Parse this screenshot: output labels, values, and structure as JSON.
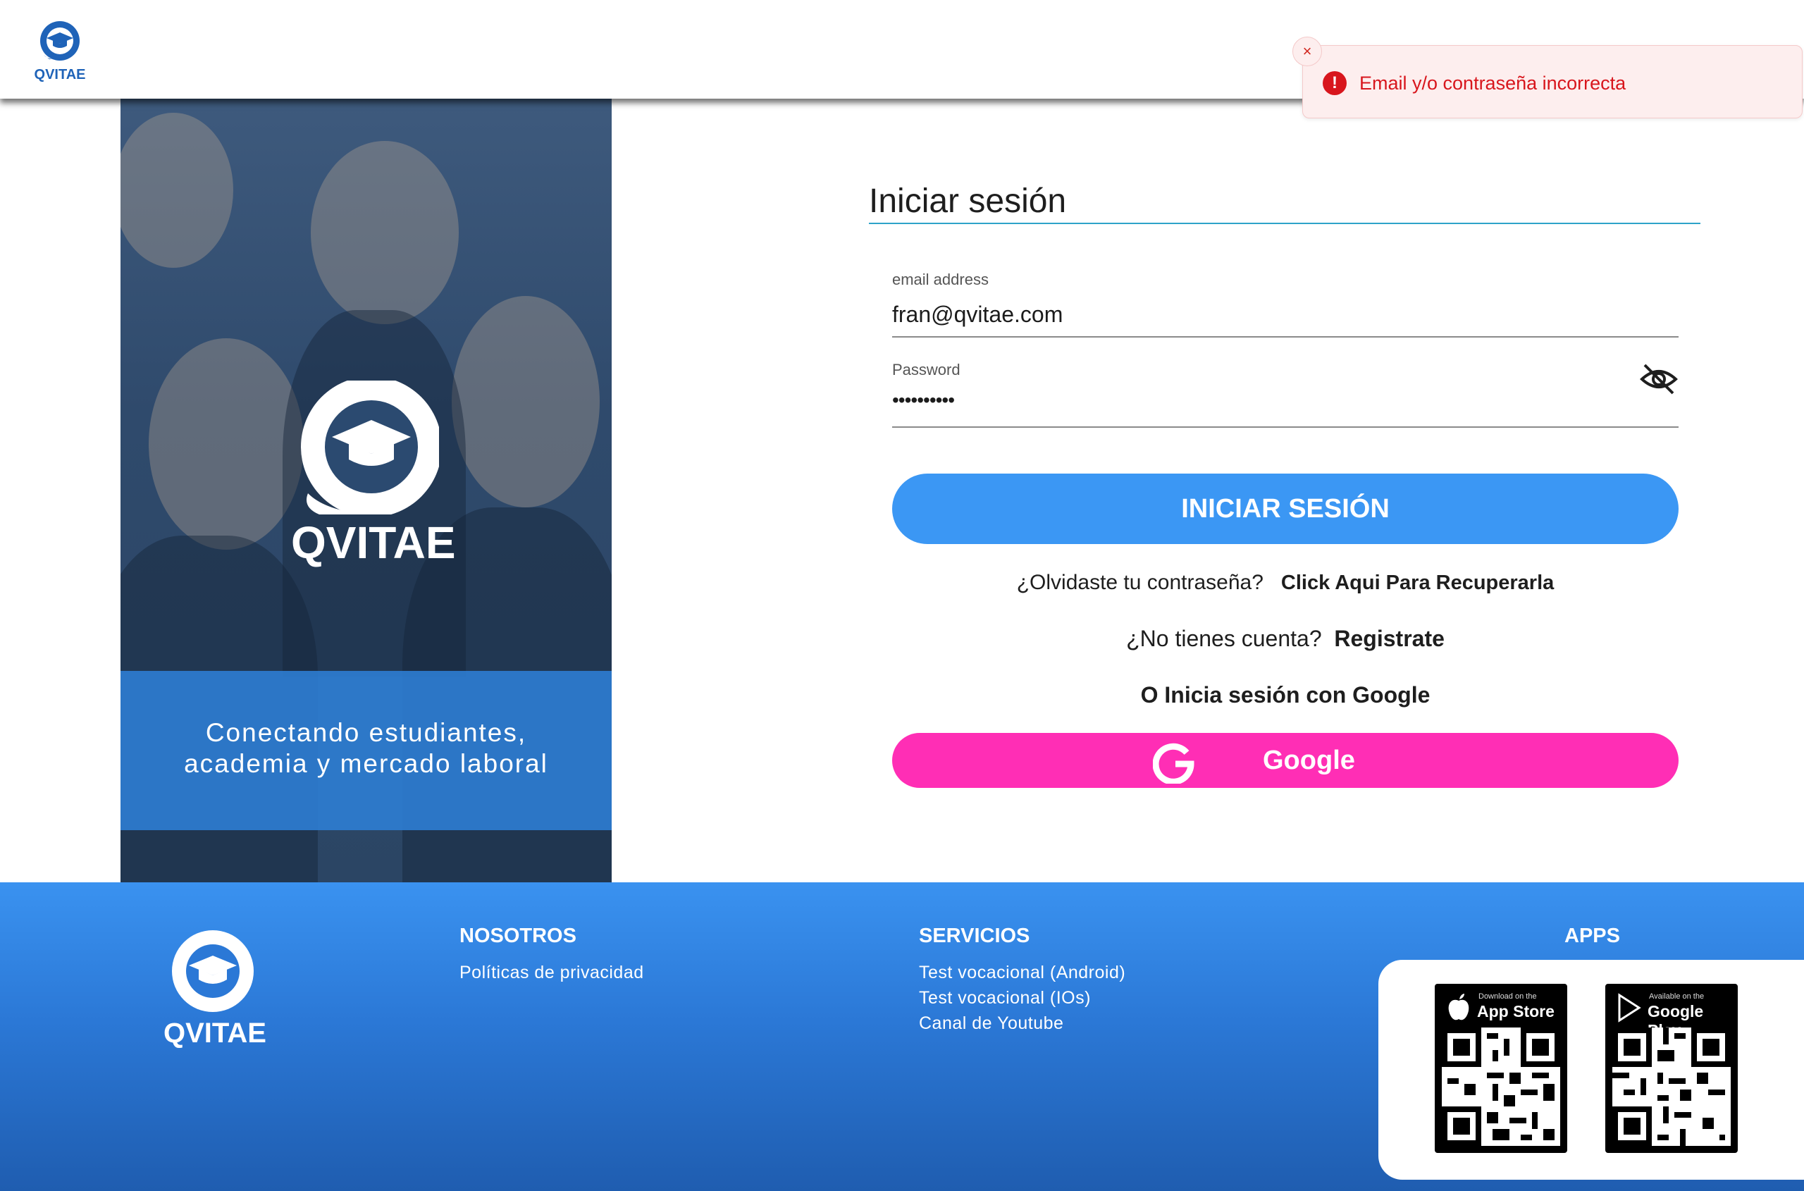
{
  "header": {
    "logo_text": "QVITAE"
  },
  "toast": {
    "close_symbol": "×",
    "icon_symbol": "!",
    "message": "Email y/o contraseña incorrecta",
    "color": "#d8161d"
  },
  "hero": {
    "logo_text": "QVITAE",
    "tagline_line1": "Conectando estudiantes,",
    "tagline_line2": "academia y mercado laboral"
  },
  "form": {
    "title": "Iniciar sesión",
    "email": {
      "label": "email address",
      "value": "fran@qvitae.com"
    },
    "password": {
      "label": "Password",
      "value": "••••••••••",
      "toggle_icon": "eye-off-icon"
    },
    "login_button": "INICIAR SESIÓN",
    "forgot_text": "¿Olvidaste tu contraseña?",
    "forgot_link": "Click Aqui Para Recuperarla",
    "register_text": "¿No tienes cuenta?",
    "register_link": "Registrate",
    "google_prompt": "O Inicia sesión con Google",
    "google_button": "Google"
  },
  "footer": {
    "logo_text": "QVITAE",
    "nosotros": {
      "heading": "NOSOTROS",
      "links": [
        "Políticas de privacidad"
      ]
    },
    "servicios": {
      "heading": "SERVICIOS",
      "links": [
        "Test vocacional (Android)",
        "Test vocacional (IOs)",
        "Canal de Youtube"
      ]
    },
    "apps": {
      "heading": "APPS",
      "app_store": {
        "small": "Download on the",
        "big": "App Store"
      },
      "google_play": {
        "small": "Available on the",
        "big": "Google Play"
      }
    }
  },
  "colors": {
    "primary_button": "#3b97f4",
    "google_button": "#ff2eb5",
    "brand": "#1f63b8"
  }
}
